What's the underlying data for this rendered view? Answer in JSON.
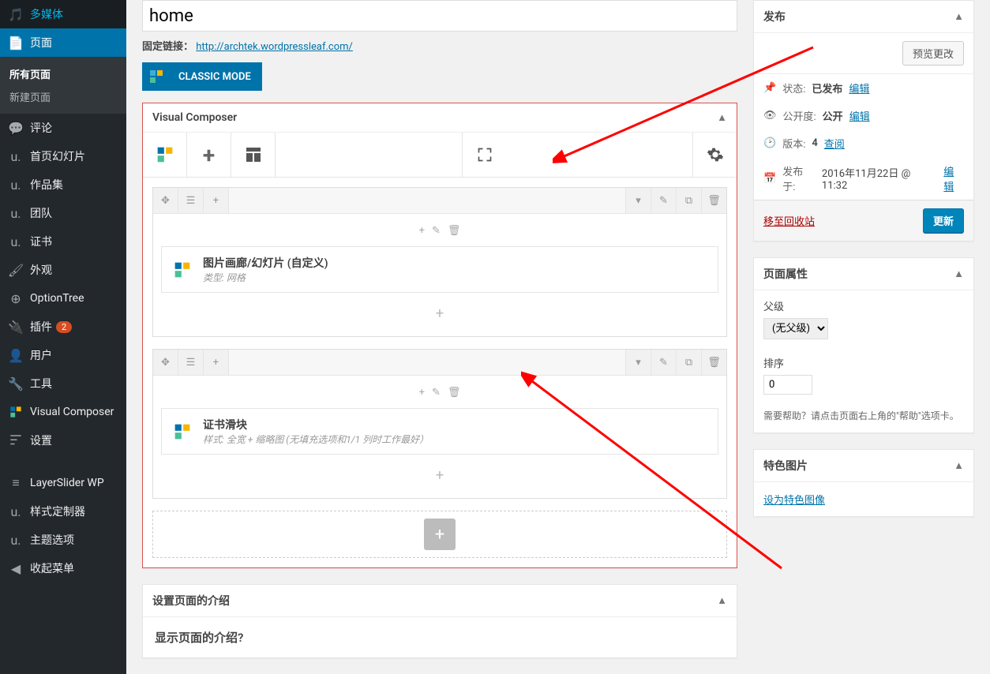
{
  "sidebar": {
    "items": [
      {
        "label": "多媒体",
        "icon": "media"
      },
      {
        "label": "页面",
        "icon": "page",
        "active": true
      },
      {
        "label": "评论",
        "icon": "comments"
      },
      {
        "label": "首页幻灯片",
        "icon": "uk"
      },
      {
        "label": "作品集",
        "icon": "uk"
      },
      {
        "label": "团队",
        "icon": "uk"
      },
      {
        "label": "证书",
        "icon": "uk"
      },
      {
        "label": "外观",
        "icon": "appearance"
      },
      {
        "label": "OptionTree",
        "icon": "optiontree"
      },
      {
        "label": "插件",
        "icon": "plugins",
        "badge": "2"
      },
      {
        "label": "用户",
        "icon": "users"
      },
      {
        "label": "工具",
        "icon": "tools"
      },
      {
        "label": "Visual Composer",
        "icon": "vc"
      },
      {
        "label": "设置",
        "icon": "settings"
      },
      {
        "label": "LayerSlider WP",
        "icon": "layers"
      },
      {
        "label": "样式定制器",
        "icon": "uk"
      },
      {
        "label": "主题选项",
        "icon": "uk"
      },
      {
        "label": "收起菜单",
        "icon": "collapse"
      }
    ],
    "submenu": {
      "all": "所有页面",
      "new": "新建页面"
    }
  },
  "title": "home",
  "permalink": {
    "label": "固定链接：",
    "url": "http://archtek.wordpressleaf.com/"
  },
  "classic_mode": "CLASSIC MODE",
  "vc_panel": {
    "title": "Visual Composer",
    "rows": [
      {
        "element_title": "图片画廊/幻灯片 (自定义)",
        "element_desc": "类型: 网格"
      },
      {
        "element_title": "证书滑块",
        "element_desc": "样式: 全宽 + 缩略图   (无填充选项和1/1 列时工作最好）"
      }
    ]
  },
  "intro_panel": {
    "title": "设置页面的介绍",
    "question": "显示页面的介绍?"
  },
  "publish": {
    "title": "发布",
    "preview": "预览更改",
    "status_label": "状态:",
    "status_value": "已发布",
    "visibility_label": "公开度:",
    "visibility_value": "公开",
    "revisions_label": "版本:",
    "revisions_value": "4",
    "revisions_link": "查阅",
    "published_label": "发布于:",
    "published_value": "2016年11月22日 @ 11:32",
    "edit_link": "编辑",
    "trash": "移至回收站",
    "update": "更新"
  },
  "page_attrs": {
    "title": "页面属性",
    "parent_label": "父级",
    "parent_value": "(无父级)",
    "order_label": "排序",
    "order_value": "0",
    "help": "需要帮助？请点击页面右上角的\"帮助\"选项卡。"
  },
  "featured": {
    "title": "特色图片",
    "link": "设为特色图像"
  }
}
